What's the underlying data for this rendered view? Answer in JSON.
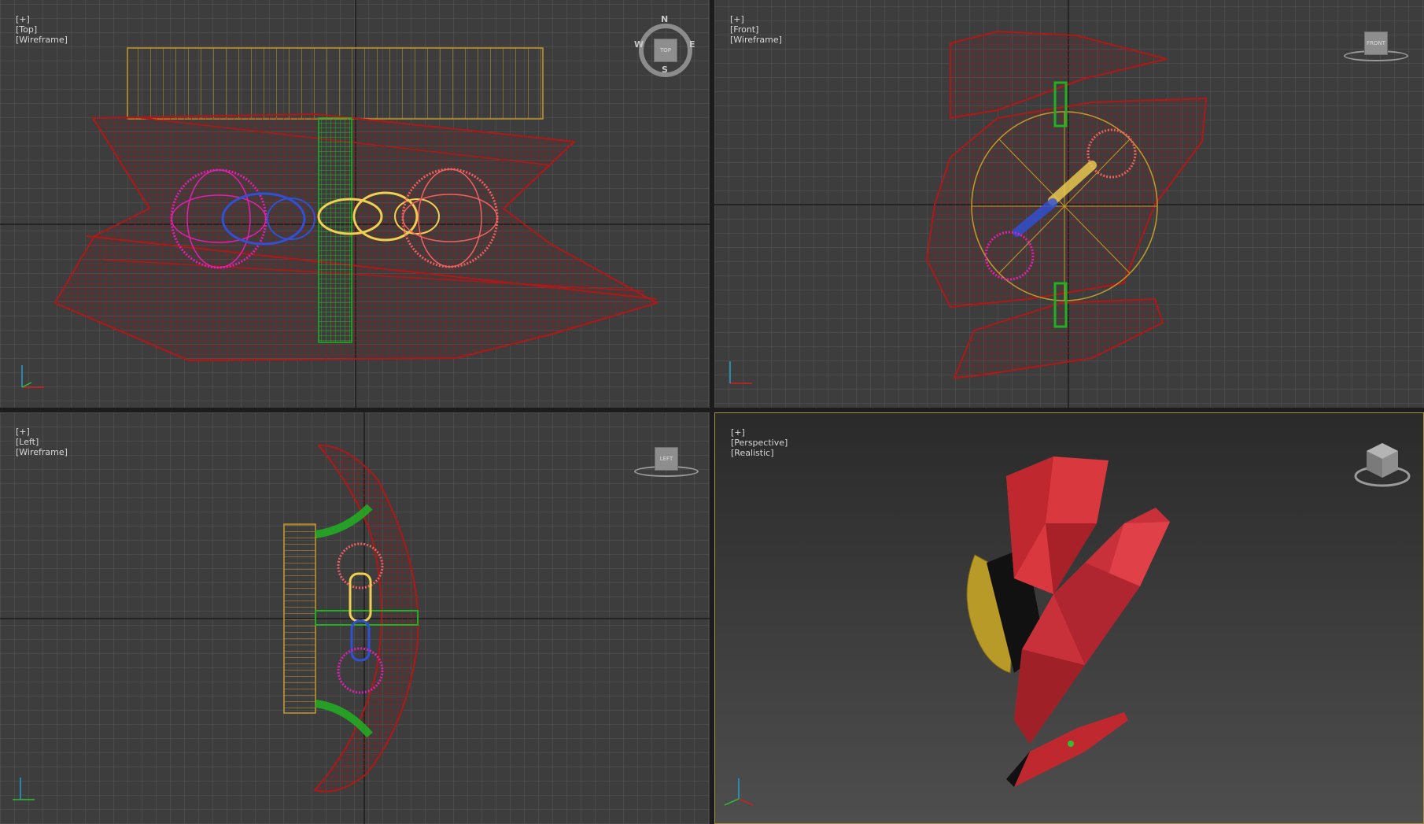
{
  "viewports": {
    "top": {
      "plus": "[+]",
      "view": "[Top]",
      "mode": "[Wireframe]",
      "cube_label": "TOP"
    },
    "front": {
      "plus": "[+]",
      "view": "[Front]",
      "mode": "[Wireframe]",
      "cube_label": "FRONT"
    },
    "left": {
      "plus": "[+]",
      "view": "[Left]",
      "mode": "[Wireframe]",
      "cube_label": "LEFT"
    },
    "perspective": {
      "plus": "[+]",
      "view": "[Perspective]",
      "mode": "[Realistic]"
    }
  },
  "compass": {
    "n": "N",
    "s": "S",
    "e": "E",
    "w": "W"
  },
  "axis_letters": {
    "x": "x",
    "y": "y",
    "z": "z"
  },
  "colors": {
    "viewport_bg": "#3c3c3c",
    "grid": "#5a5a5a",
    "wire_red": "#b01818",
    "wire_magenta": "#e020b0",
    "wire_blue": "#3050d8",
    "wire_yellow": "#f0d050",
    "wire_green": "#20b020",
    "wire_gold": "#c8a030",
    "active_border": "#a89048"
  }
}
